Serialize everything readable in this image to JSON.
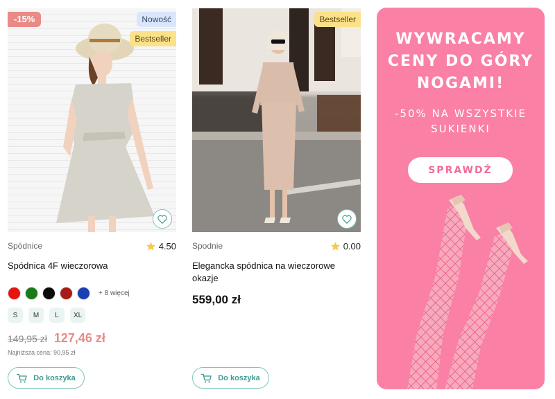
{
  "products": [
    {
      "discount_badge": "-15%",
      "badges": [
        "Nowość",
        "Bestseller"
      ],
      "category": "Spódnice",
      "rating": "4.50",
      "name": "Spódnica 4F wieczorowa",
      "colors": [
        "#e8140e",
        "#1a7a1a",
        "#0a0a0a",
        "#a81a1a",
        "#1a3fb0"
      ],
      "more_colors": "+ 8 więcej",
      "sizes": [
        "S",
        "M",
        "L",
        "XL"
      ],
      "price_old": "149,95 zł",
      "price_new": "127,46 zł",
      "price_lowest": "Najniższa cena: 90,95 zł",
      "cart_label": "Do koszyka"
    },
    {
      "badges": [
        "Bestseller"
      ],
      "category": "Spodnie",
      "rating": "0.00",
      "name": "Elegancka spódnica na wieczorowe okazje",
      "price": "559,00 zł",
      "cart_label": "Do koszyka"
    }
  ],
  "promo": {
    "title": "WYWRACAMY CENY DO GÓRY NOGAMI!",
    "subtitle": "-50% NA WSZYSTKIE SUKIENKI",
    "button_label": "SPRAWDŹ",
    "background": "#fa80a6"
  },
  "colors": {
    "accent_teal": "#3d9c93",
    "sale_pink": "#e98a86"
  },
  "icons": {
    "favorite": "heart-icon",
    "rating": "star-icon",
    "cart": "cart-icon"
  }
}
